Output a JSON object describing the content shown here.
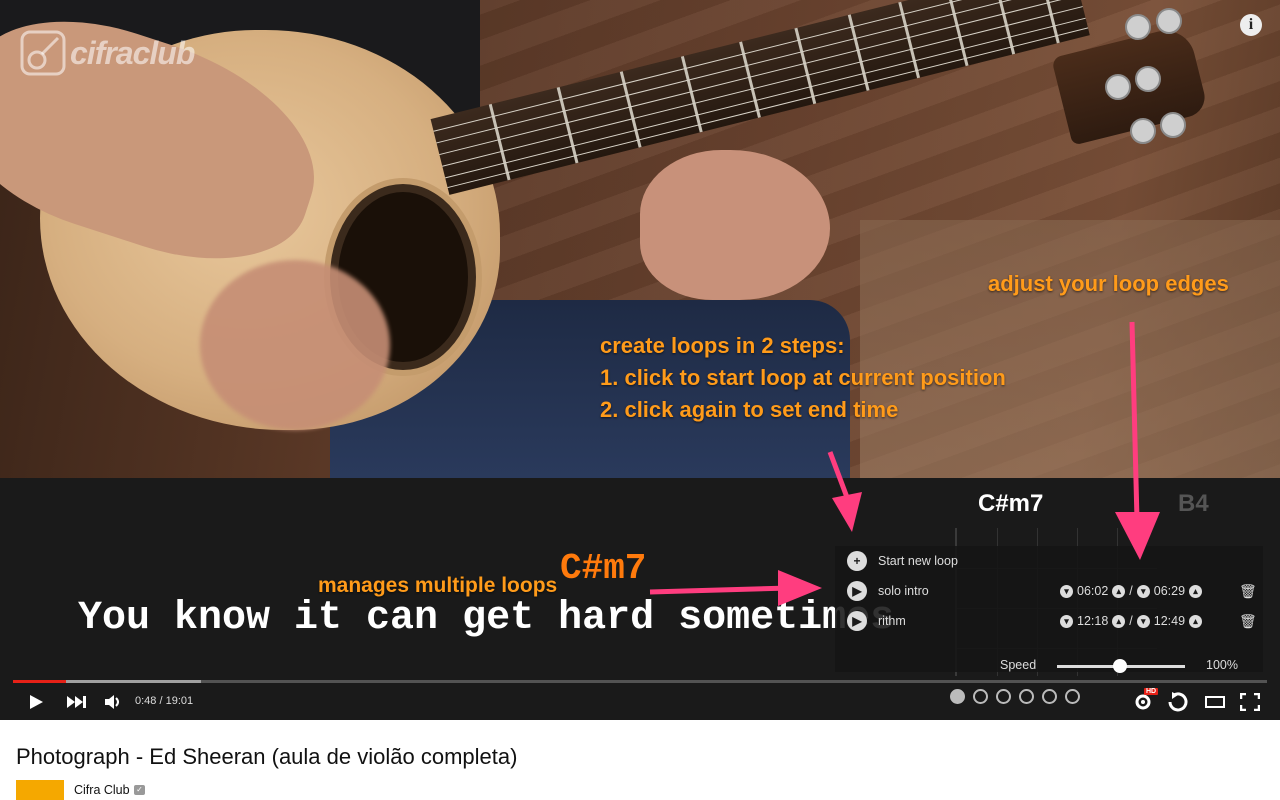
{
  "overlay": {
    "logo_text": "cifraclub",
    "info_icon": "i"
  },
  "annotations": {
    "edges": "adjust your loop edges",
    "create_title": "create loops in 2 steps:",
    "create_step1": "1. click to start loop at current position",
    "create_step2": "2. click again to set end time",
    "multi": "manages multiple loops",
    "color": "#ff9b1a",
    "arrow_color": "#ff3d7f"
  },
  "lyrics": {
    "chord": "C#m7",
    "line": "You know it can get hard sometimes"
  },
  "chords": {
    "current": "C#m7",
    "next": "B4"
  },
  "loops": {
    "new_loop_label": "Start new loop",
    "items": [
      {
        "name": "solo intro",
        "start": "06:02",
        "end": "06:29"
      },
      {
        "name": "rithm",
        "start": "12:18",
        "end": "12:49"
      }
    ],
    "speed_label": "Speed",
    "speed_value": "100%"
  },
  "player": {
    "time": "0:48 / 19:01",
    "progress_fraction": 0.042,
    "buffer_fraction": 0.15,
    "hd_badge": "HD",
    "slide_dots": 6,
    "active_dot": 0
  },
  "video": {
    "title": "Photograph - Ed Sheeran (aula de violão completa)",
    "channel": "Cifra Club"
  }
}
